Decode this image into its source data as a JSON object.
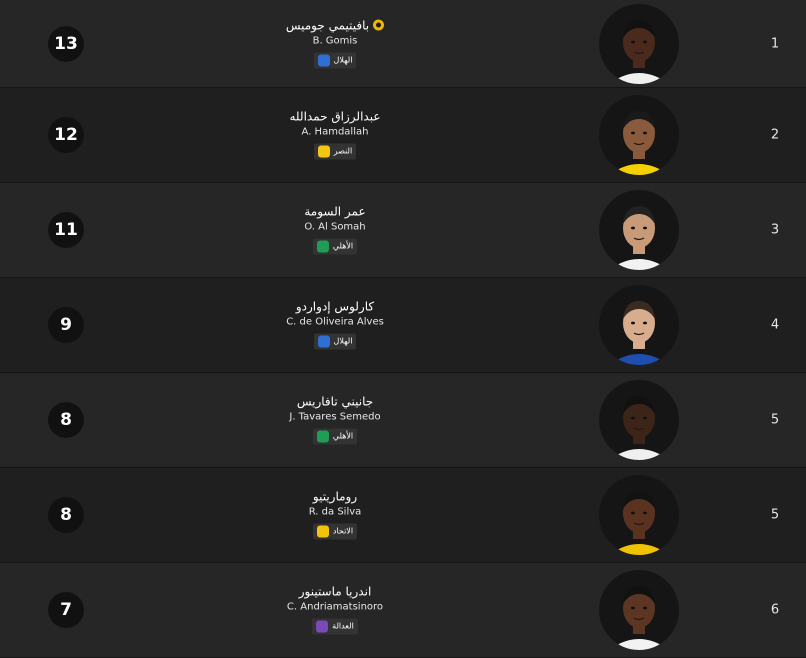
{
  "players": [
    {
      "rank": "1",
      "goals": "13",
      "name_ar": "بافيتيمي جوميس",
      "name_en": "B. Gomis",
      "club": "الهلال",
      "club_color": "#2f6fd1",
      "skin": "#4a2a1c",
      "hair": "#111111",
      "shirt": "#f0f0f0",
      "top_icon": "ball-icon"
    },
    {
      "rank": "2",
      "goals": "12",
      "name_ar": "عبدالرزاق حمدالله",
      "name_en": "A. Hamdallah",
      "club": "النصر",
      "club_color": "#f3c613",
      "skin": "#8a5a3c",
      "hair": "#1a1a1a",
      "shirt": "#f5d000",
      "top_icon": ""
    },
    {
      "rank": "3",
      "goals": "11",
      "name_ar": "عمر السومة",
      "name_en": "O. Al Somah",
      "club": "الأهلي",
      "club_color": "#1f9d55",
      "skin": "#c99a78",
      "hair": "#222222",
      "shirt": "#f2f2f2",
      "top_icon": ""
    },
    {
      "rank": "4",
      "goals": "9",
      "name_ar": "كارلوس إدواردو",
      "name_en": "C. de Oliveira Alves",
      "club": "الهلال",
      "club_color": "#2f6fd1",
      "skin": "#d7ad8e",
      "hair": "#3a2b20",
      "shirt": "#1e4fb0",
      "top_icon": ""
    },
    {
      "rank": "5",
      "goals": "8",
      "name_ar": "جانيني تافاريس",
      "name_en": "J. Tavares Semedo",
      "club": "الأهلي",
      "club_color": "#1f9d55",
      "skin": "#3d2418",
      "hair": "#111111",
      "shirt": "#efefef",
      "top_icon": ""
    },
    {
      "rank": "5",
      "goals": "8",
      "name_ar": "روماريتيو",
      "name_en": "R. da Silva",
      "club": "الاتحاد",
      "club_color": "#f1c40f",
      "skin": "#5a3320",
      "hair": "#121212",
      "shirt": "#f0c300",
      "top_icon": ""
    },
    {
      "rank": "6",
      "goals": "7",
      "name_ar": "اندريا ماستينور",
      "name_en": "C. Andriamatsinoro",
      "club": "العدالة",
      "club_color": "#7b4ab8",
      "skin": "#5c3622",
      "hair": "#111111",
      "shirt": "#f2f2f2",
      "top_icon": ""
    }
  ]
}
